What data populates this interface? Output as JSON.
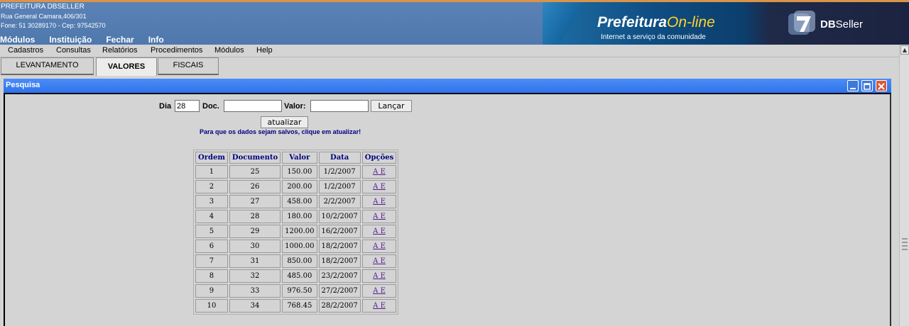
{
  "header": {
    "org_name": "PREFEITURA DBSELLER",
    "address": "Rua General Camara,406/301",
    "contact": "Fone: 51 30289170  -  Cep: 97542570",
    "nav": [
      "Módulos",
      "Instituição",
      "Fechar",
      "Info"
    ]
  },
  "banner": {
    "logo_prefix": "Prefeitura",
    "logo_suffix": "On-line",
    "tagline": "Internet a serviço da comunidade",
    "brand_bold": "DB",
    "brand_rest": "Seller"
  },
  "menu": [
    "Cadastros",
    "Consultas",
    "Relatórios",
    "Procedimentos",
    "Módulos",
    "Help"
  ],
  "tabs": [
    {
      "label": "LEVANTAMENTO",
      "active": false
    },
    {
      "label": "VALORES",
      "active": true
    },
    {
      "label": "FISCAIS",
      "active": false
    }
  ],
  "window": {
    "title": "Pesquisa",
    "controls": [
      "minimize-icon",
      "maximize-icon",
      "close-icon"
    ]
  },
  "form": {
    "dia_label": "Dia",
    "dia_value": "28",
    "doc_label": "Doc.",
    "doc_value": "",
    "valor_label": "Valor:",
    "valor_value": "",
    "launch_button": "Lançar",
    "update_button": "atualizar",
    "notice": "Para que os dados sejam salvos, clique em atualizar!"
  },
  "table": {
    "headers": [
      "Ordem",
      "Documento",
      "Valor",
      "Data",
      "Opções"
    ],
    "option_a": "A",
    "option_e": "E",
    "rows": [
      [
        "1",
        "25",
        "150.00",
        "1/2/2007"
      ],
      [
        "2",
        "26",
        "200.00",
        "1/2/2007"
      ],
      [
        "3",
        "27",
        "458.00",
        "2/2/2007"
      ],
      [
        "4",
        "28",
        "180.00",
        "10/2/2007"
      ],
      [
        "5",
        "29",
        "1200.00",
        "16/2/2007"
      ],
      [
        "6",
        "30",
        "1000.00",
        "18/2/2007"
      ],
      [
        "7",
        "31",
        "850.00",
        "18/2/2007"
      ],
      [
        "8",
        "32",
        "485.00",
        "23/2/2007"
      ],
      [
        "9",
        "33",
        "976.50",
        "27/2/2007"
      ],
      [
        "10",
        "34",
        "768.45",
        "28/2/2007"
      ]
    ]
  },
  "colors": {
    "header_bg": "#5a82b6",
    "title_bar": "#3a7ff0",
    "table_header_text": "#000080",
    "link": "#551a8b"
  }
}
